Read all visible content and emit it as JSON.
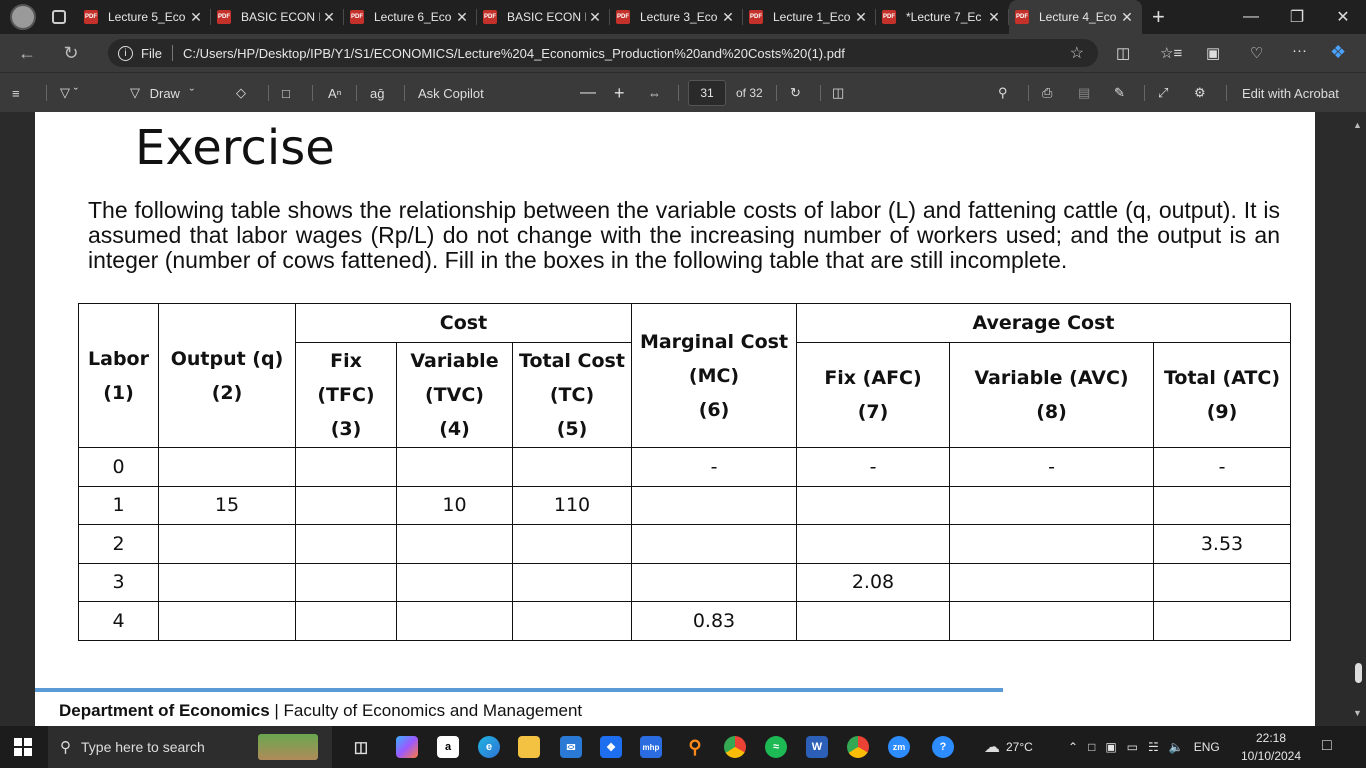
{
  "browser": {
    "tabs": [
      {
        "title": "Lecture 5_Eco",
        "active": false
      },
      {
        "title": "BASIC ECON I",
        "active": false
      },
      {
        "title": "Lecture 6_Eco",
        "active": false
      },
      {
        "title": "BASIC ECON I",
        "active": false
      },
      {
        "title": "Lecture 3_Eco",
        "active": false
      },
      {
        "title": "Lecture 1_Eco",
        "active": false
      },
      {
        "title": "*Lecture 7_Ec",
        "active": false
      },
      {
        "title": "Lecture 4_Eco",
        "active": true
      }
    ],
    "file_label": "File",
    "url": "C:/Users/HP/Desktop/IPB/Y1/S1/ECONOMICS/Lecture%204_Economics_Production%20and%20Costs%20(1).pdf"
  },
  "pdf_toolbar": {
    "draw_label": "Draw",
    "ask_copilot_label": "Ask Copilot",
    "current_page": "31",
    "page_of": "of 32",
    "edit_acrobat_label": "Edit with Acrobat"
  },
  "document": {
    "title": "Exercise",
    "description": "The following table shows the relationship between the variable costs of labor (L) and fattening cattle (q, output). It is assumed that labor wages (Rp/L) do not change with the increasing number of workers used; and the output is an integer (number of cows fattened). Fill in the boxes in the following table that are still incomplete.",
    "table": {
      "group_headers": {
        "cost": "Cost",
        "average_cost": "Average Cost"
      },
      "headers": {
        "labor": {
          "name": "Labor",
          "num": "(1)"
        },
        "output": {
          "name": "Output (q)",
          "num": "(2)"
        },
        "fix": {
          "name": "Fix",
          "abbr": "(TFC)",
          "num": "(3)"
        },
        "variable": {
          "name": "Variable",
          "abbr": "(TVC)",
          "num": "(4)"
        },
        "total": {
          "name": "Total Cost",
          "abbr": "(TC)",
          "num": "(5)"
        },
        "mc": {
          "name": "Marginal Cost",
          "abbr": "(MC)",
          "num": "(6)"
        },
        "afc": {
          "name": "Fix (AFC)",
          "num": "(7)"
        },
        "avc": {
          "name": "Variable (AVC)",
          "num": "(8)"
        },
        "atc": {
          "name": "Total (ATC)",
          "num": "(9)"
        }
      },
      "rows": [
        [
          "0",
          "",
          "",
          "",
          "",
          "-",
          "-",
          "-",
          "-"
        ],
        [
          "1",
          "15",
          "",
          "10",
          "110",
          "",
          "",
          "",
          ""
        ],
        [
          "2",
          "",
          "",
          "",
          "",
          "",
          "",
          "",
          "3.53"
        ],
        [
          "3",
          "",
          "",
          "",
          "",
          "",
          "2.08",
          "",
          ""
        ],
        [
          "4",
          "",
          "",
          "",
          "",
          "0.83",
          "",
          "",
          ""
        ]
      ]
    },
    "footer": {
      "dept": "Department of Economics",
      "sep": "|",
      "faculty": "Faculty of Economics and Management"
    }
  },
  "taskbar": {
    "search_placeholder": "Type here to search",
    "weather": "27°C",
    "lang": "ENG",
    "time": "22:18",
    "date": "10/10/2024"
  }
}
